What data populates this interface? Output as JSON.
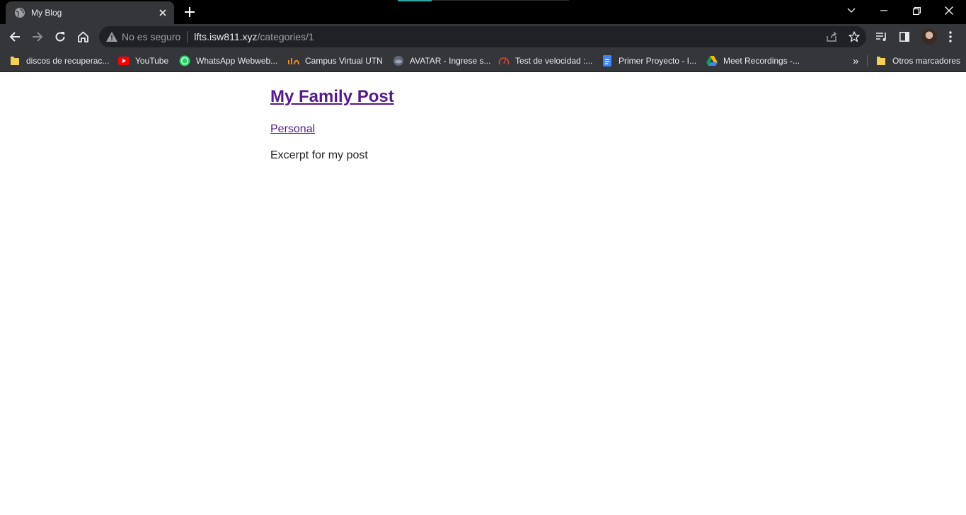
{
  "tab": {
    "title": "My Blog"
  },
  "omnibox": {
    "security_label": "No es seguro",
    "host": "lfts.isw811.xyz",
    "path": "/categories/1"
  },
  "bookmarks": [
    {
      "label": "discos de recuperac...",
      "icon": "folder-icon"
    },
    {
      "label": "YouTube",
      "icon": "youtube-icon"
    },
    {
      "label": "WhatsApp Webweb...",
      "icon": "whatsapp-icon"
    },
    {
      "label": "Campus Virtual UTN",
      "icon": "campus-icon"
    },
    {
      "label": "AVATAR - Ingrese s...",
      "icon": "avatar-site-icon"
    },
    {
      "label": "Test de velocidad :...",
      "icon": "speedtest-icon"
    },
    {
      "label": "Primer Proyecto - I...",
      "icon": "docs-icon"
    },
    {
      "label": "Meet Recordings -...",
      "icon": "drive-icon"
    }
  ],
  "bookmarks_overflow": "»",
  "other_bookmarks": "Otros marcadores",
  "post": {
    "title": "My Family Post",
    "category": "Personal",
    "excerpt": "Excerpt for my post"
  },
  "colors": {
    "link_visited": "#551a8b",
    "chrome_dark": "#35363a",
    "omnibox_bg": "#202124",
    "tab_accent": "#2aa7a1"
  }
}
